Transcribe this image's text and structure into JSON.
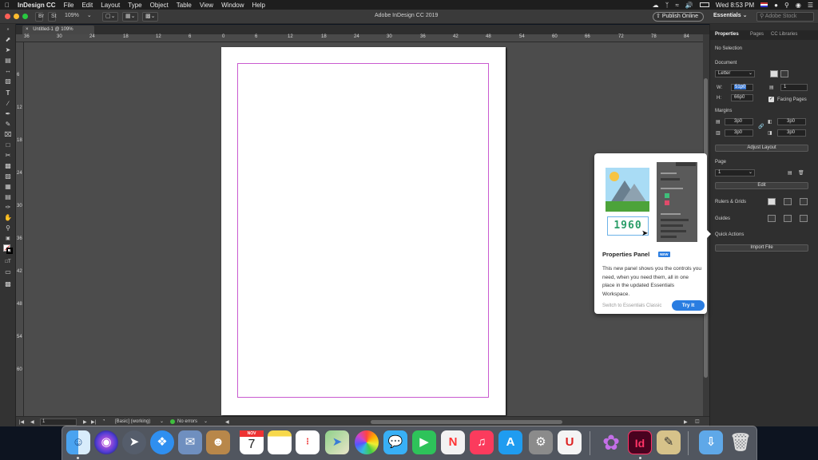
{
  "menubar": {
    "app_name": "InDesign CC",
    "items": [
      "File",
      "Edit",
      "Layout",
      "Type",
      "Object",
      "Table",
      "View",
      "Window",
      "Help"
    ],
    "clock": "Wed 8:53 PM"
  },
  "appbar": {
    "zoom": "109%",
    "window_title": "Adobe InDesign CC 2019",
    "publish_online": "Publish Online",
    "workspace": "Essentials",
    "search_placeholder": "Adobe Stock"
  },
  "document": {
    "tab_title": "Untitled-1 @ 109%"
  },
  "rulers": {
    "horizontal": [
      "36",
      "30",
      "24",
      "18",
      "12",
      "6",
      "0",
      "6",
      "12",
      "18",
      "24",
      "30",
      "36",
      "42",
      "48",
      "54",
      "60",
      "66",
      "72",
      "78",
      "84"
    ],
    "vertical": [
      "6",
      "12",
      "18",
      "24",
      "30",
      "36",
      "42",
      "48",
      "54",
      "60"
    ]
  },
  "statusbar": {
    "page": "1",
    "preflight_profile": "[Basic] (working)",
    "errors": "No errors"
  },
  "properties_panel": {
    "tabs": [
      "Properties",
      "Pages",
      "CC Libraries"
    ],
    "selection": "No Selection",
    "document_section": "Document",
    "page_size": "Letter",
    "width_label": "W:",
    "width_value": "51p0",
    "height_label": "H:",
    "height_value": "66p0",
    "pages_count": "1",
    "facing_pages": "Facing Pages",
    "margins_section": "Margins",
    "margin_top": "3p0",
    "margin_bottom": "3p0",
    "margin_left": "3p0",
    "margin_right": "3p0",
    "adjust_layout": "Adjust Layout",
    "page_section": "Page",
    "page_value": "1",
    "edit_button": "Edit",
    "rulers_grids": "Rulers & Grids",
    "guides": "Guides",
    "quick_actions": "Quick Actions",
    "import_file": "Import File"
  },
  "popup": {
    "year_label": "1960",
    "title": "Properties Panel",
    "badge": "NEW",
    "body": "This new panel shows you the controls you need, when you need them, all in one place in the updated Essentials Workspace.",
    "switch_link": "Switch to Essentials Classic",
    "try_button": "Try It"
  },
  "dock": {
    "calendar_month": "NOV",
    "calendar_day": "7",
    "indesign_label": "Id"
  },
  "colors": {
    "accent_blue": "#2a7de1",
    "margin_guide": "#c95bd0",
    "no_errors_dot": "#3fbf3f"
  }
}
